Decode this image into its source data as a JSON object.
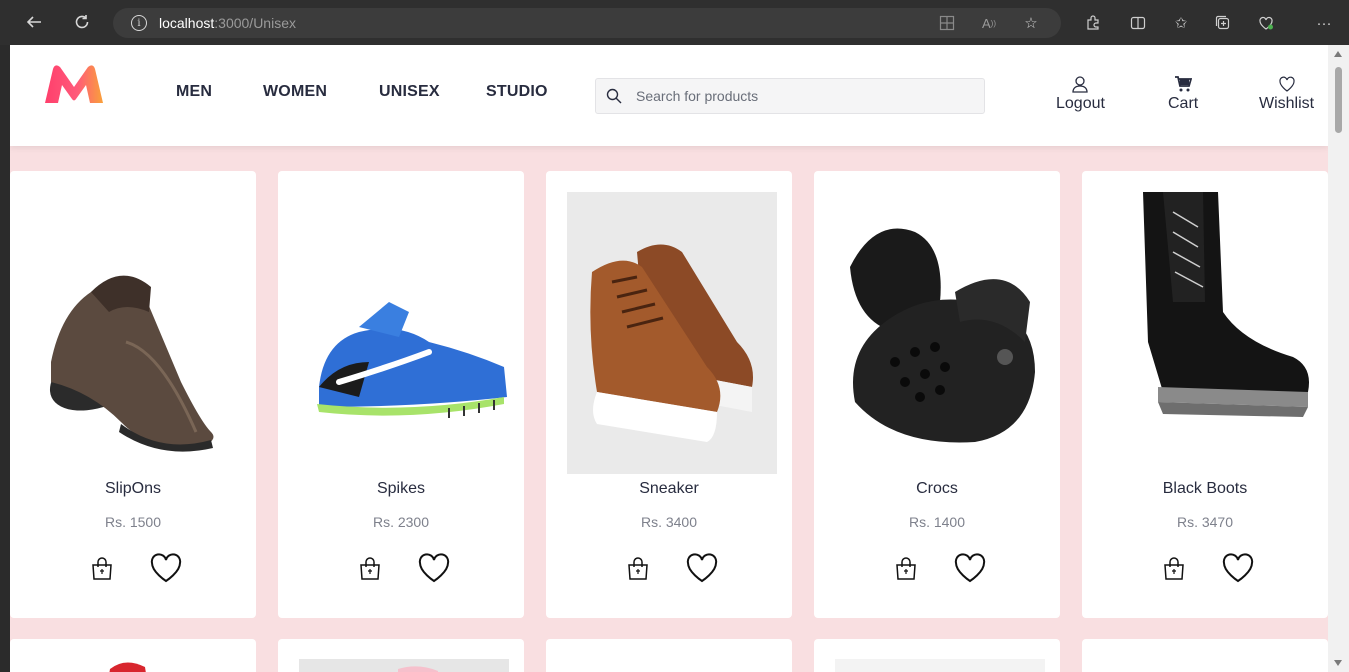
{
  "browser": {
    "url_host": "localhost",
    "url_path": ":3000/Unisex"
  },
  "header": {
    "nav": [
      "MEN",
      "WOMEN",
      "UNISEX",
      "STUDIO"
    ],
    "search_placeholder": "Search for products",
    "actions": {
      "logout": "Logout",
      "cart": "Cart",
      "wishlist": "Wishlist"
    }
  },
  "products": [
    {
      "name": "SlipOns",
      "price": "Rs. 1500"
    },
    {
      "name": "Spikes",
      "price": "Rs. 2300"
    },
    {
      "name": "Sneaker",
      "price": "Rs. 3400"
    },
    {
      "name": "Crocs",
      "price": "Rs. 1400"
    },
    {
      "name": "Black Boots",
      "price": "Rs. 3470"
    }
  ],
  "colors": {
    "page_bg": "#f9dfe1",
    "logo_pink": "#ff3f6c",
    "logo_orange": "#f9a13a",
    "text_dark": "#282c3f"
  }
}
